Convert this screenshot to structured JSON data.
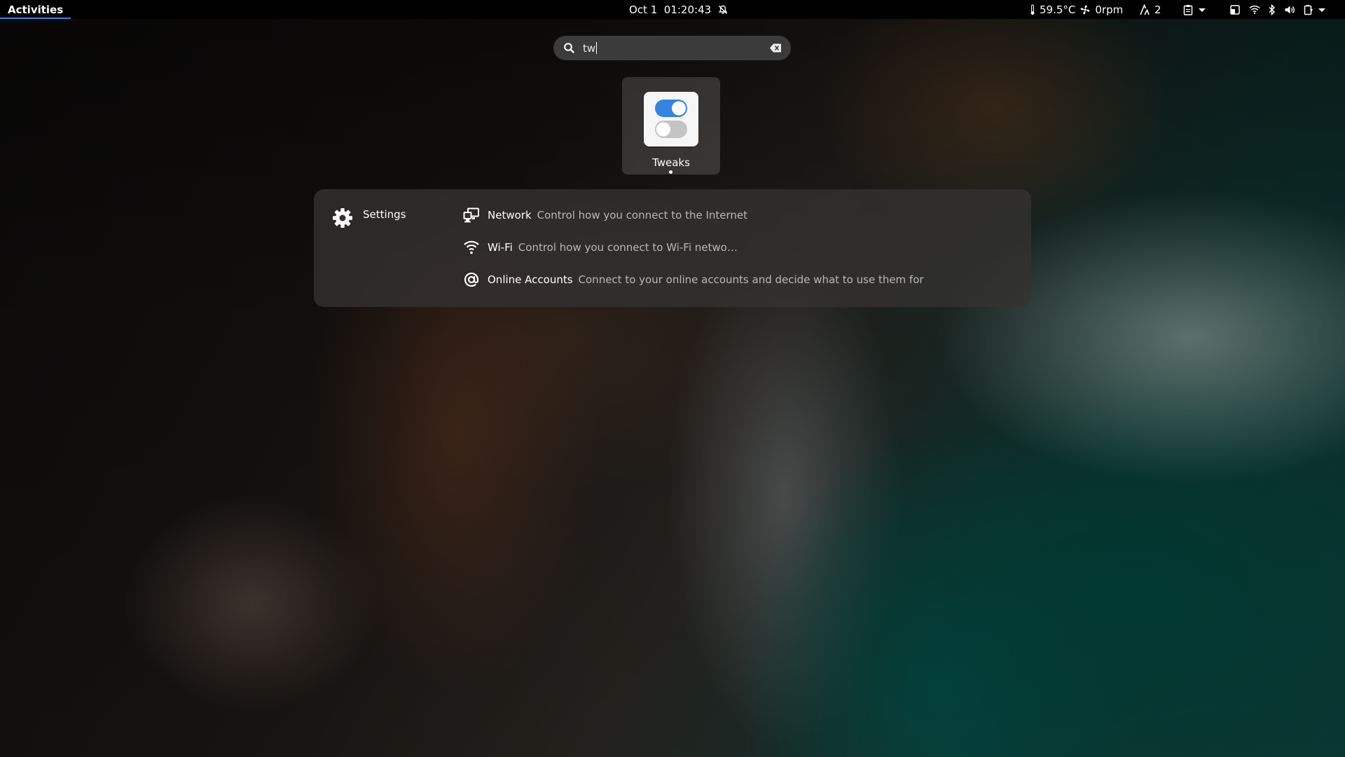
{
  "topbar": {
    "activities_label": "Activities",
    "clock": "Oct 1  01:20:43",
    "sensors": "59.5°C",
    "fan": "0rpm",
    "workspaces_count": "2"
  },
  "search": {
    "query": "tw"
  },
  "app_result": {
    "name": "Tweaks",
    "running": true,
    "toggle_on_color": "#3584e4"
  },
  "settings_provider": {
    "name": "Settings",
    "results": [
      {
        "icon": "network-icon",
        "title": "Network",
        "description": "Control how you connect to the Internet"
      },
      {
        "icon": "wifi-icon",
        "title": "Wi-Fi",
        "description": "Control how you connect to Wi-Fi netwo…"
      },
      {
        "icon": "at-sign-icon",
        "title": "Online Accounts",
        "description": "Connect to your online accounts and decide what to use them for"
      }
    ]
  },
  "colors": {
    "accent": "#3584e4",
    "topbar_bg": "#000000"
  }
}
